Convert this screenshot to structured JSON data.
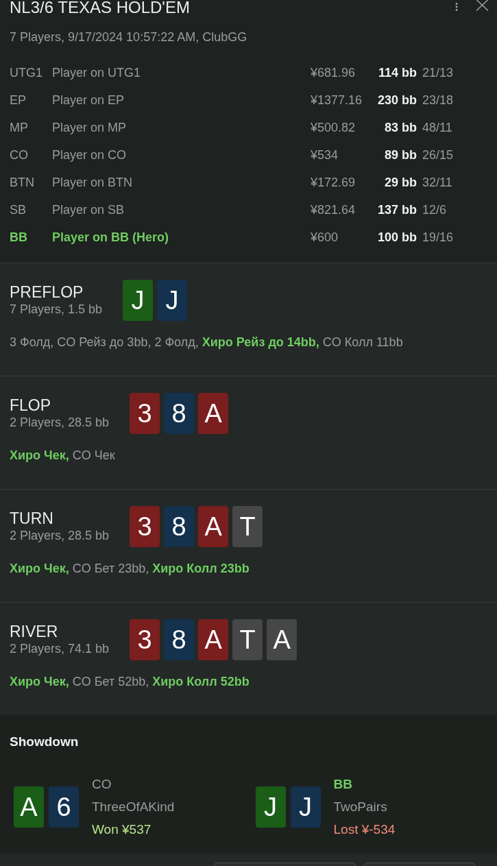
{
  "header": {
    "title": "NL3/6 TEXAS HOLD'EM",
    "subtitle": "7 Players, 9/17/2024 10:57:22 AM, ClubGG"
  },
  "players": [
    {
      "position": "UTG1",
      "name": "Player on UTG1",
      "stack": "¥681.96",
      "stack_bb": "114 bb",
      "stats": "21/13",
      "hero": false
    },
    {
      "position": "EP",
      "name": "Player on EP",
      "stack": "¥1377.16",
      "stack_bb": "230 bb",
      "stats": "23/18",
      "hero": false
    },
    {
      "position": "MP",
      "name": "Player on MP",
      "stack": "¥500.82",
      "stack_bb": "83 bb",
      "stats": "48/11",
      "hero": false
    },
    {
      "position": "CO",
      "name": "Player on CO",
      "stack": "¥534",
      "stack_bb": "89 bb",
      "stats": "26/15",
      "hero": false
    },
    {
      "position": "BTN",
      "name": "Player on BTN",
      "stack": "¥172.69",
      "stack_bb": "29 bb",
      "stats": "32/11",
      "hero": false
    },
    {
      "position": "SB",
      "name": "Player on SB",
      "stack": "¥821.64",
      "stack_bb": "137 bb",
      "stats": "12/6",
      "hero": false
    },
    {
      "position": "BB",
      "name": "Player on BB (Hero)",
      "stack": "¥600",
      "stack_bb": "100 bb",
      "stats": "19/16",
      "hero": true
    }
  ],
  "streets": [
    {
      "name": "PREFLOP",
      "info": "7 Players, 1.5 bb",
      "cards": [
        {
          "rank": "J",
          "color": "#1a5e17"
        },
        {
          "rank": "J",
          "color": "#14314d"
        }
      ],
      "actions": "3 Фолд, CO Рейз до 3bb, 2 Фолд, **Хиро Рейз до 14bb,** CO Колл 11bb"
    },
    {
      "name": "FLOP",
      "info": "2 Players, 28.5 bb",
      "cards": [
        {
          "rank": "3",
          "color": "#7a1e1e"
        },
        {
          "rank": "8",
          "color": "#14314d"
        },
        {
          "rank": "A",
          "color": "#7a1e1e"
        }
      ],
      "actions": "**Хиро Чек,** CO Чек"
    },
    {
      "name": "TURN",
      "info": "2 Players, 28.5 bb",
      "cards": [
        {
          "rank": "3",
          "color": "#7a1e1e"
        },
        {
          "rank": "8",
          "color": "#14314d"
        },
        {
          "rank": "A",
          "color": "#7a1e1e"
        },
        {
          "rank": "T",
          "color": "#474747"
        }
      ],
      "actions": "**Хиро Чек,** CO Бет 23bb, **Хиро Колл 23bb**"
    },
    {
      "name": "RIVER",
      "info": "2 Players, 74.1 bb",
      "cards": [
        {
          "rank": "3",
          "color": "#7a1e1e"
        },
        {
          "rank": "8",
          "color": "#14314d"
        },
        {
          "rank": "A",
          "color": "#7a1e1e"
        },
        {
          "rank": "T",
          "color": "#474747"
        },
        {
          "rank": "A",
          "color": "#474747"
        }
      ],
      "actions": "**Хиро Чек,** CO Бет 52bb, **Хиро Колл 52bb**"
    }
  ],
  "showdown": {
    "title": "Showdown",
    "hands": [
      {
        "position": "CO",
        "hero": false,
        "cards": [
          {
            "rank": "A",
            "color": "#1a5e17"
          },
          {
            "rank": "6",
            "color": "#14314d"
          }
        ],
        "hand_rank": "ThreeOfAKind",
        "result": "Won ¥537",
        "won": true
      },
      {
        "position": "BB",
        "hero": true,
        "cards": [
          {
            "rank": "J",
            "color": "#1a5e17"
          },
          {
            "rank": "J",
            "color": "#14314d"
          }
        ],
        "hand_rank": "TwoPairs",
        "result": "Lost ¥-534",
        "won": false
      }
    ]
  },
  "footer": {
    "buttons": [
      {
        "kind": "outline"
      },
      {
        "kind": "outline"
      }
    ]
  }
}
